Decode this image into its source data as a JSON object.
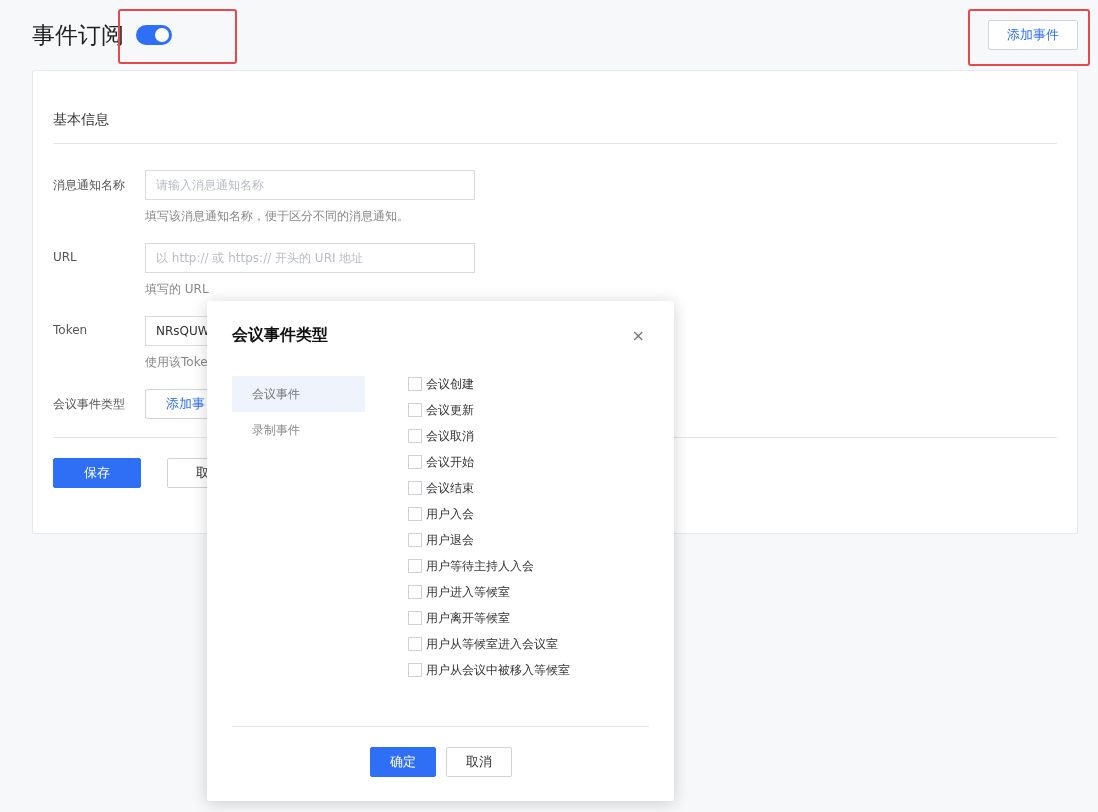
{
  "page": {
    "title": "事件订阅",
    "enabled": true,
    "add_button": "添加事件"
  },
  "section_title": "基本信息",
  "fields": [
    {
      "kind": "input",
      "label": "消息通知名称",
      "placeholder": "请输入消息通知名称",
      "hint": "填写该消息通知名称，便于区分不同的消息通知。"
    },
    {
      "kind": "input",
      "label": "URL",
      "placeholder": "以 http:// 或 https:// 开头的 URI 地址",
      "hint": "填写的 URL"
    },
    {
      "kind": "input",
      "label": "Token",
      "value": "NRsQUW",
      "hint": "使用该Toke"
    },
    {
      "kind": "button",
      "label": "会议事件类型",
      "button": "添加事"
    }
  ],
  "form_buttons": [
    {
      "label": "保存",
      "primary": true
    },
    {
      "label": "取",
      "primary": false
    }
  ],
  "dialog": {
    "title": "会议事件类型",
    "close": "×",
    "categories": [
      {
        "label": "会议事件",
        "selected": true
      },
      {
        "label": "录制事件",
        "selected": false
      }
    ],
    "events": [
      {
        "label": "会议创建",
        "checked": false
      },
      {
        "label": "会议更新",
        "checked": false
      },
      {
        "label": "会议取消",
        "checked": false
      },
      {
        "label": "会议开始",
        "checked": false
      },
      {
        "label": "会议结束",
        "checked": false
      },
      {
        "label": "用户入会",
        "checked": false
      },
      {
        "label": "用户退会",
        "checked": false
      },
      {
        "label": "用户等待主持人入会",
        "checked": false
      },
      {
        "label": "用户进入等候室",
        "checked": false
      },
      {
        "label": "用户离开等候室",
        "checked": false
      },
      {
        "label": "用户从等候室进入会议室",
        "checked": false
      },
      {
        "label": "用户从会议中被移入等候室",
        "checked": false
      }
    ],
    "buttons": [
      {
        "label": "确定",
        "primary": true
      },
      {
        "label": "取消",
        "primary": false
      }
    ]
  }
}
